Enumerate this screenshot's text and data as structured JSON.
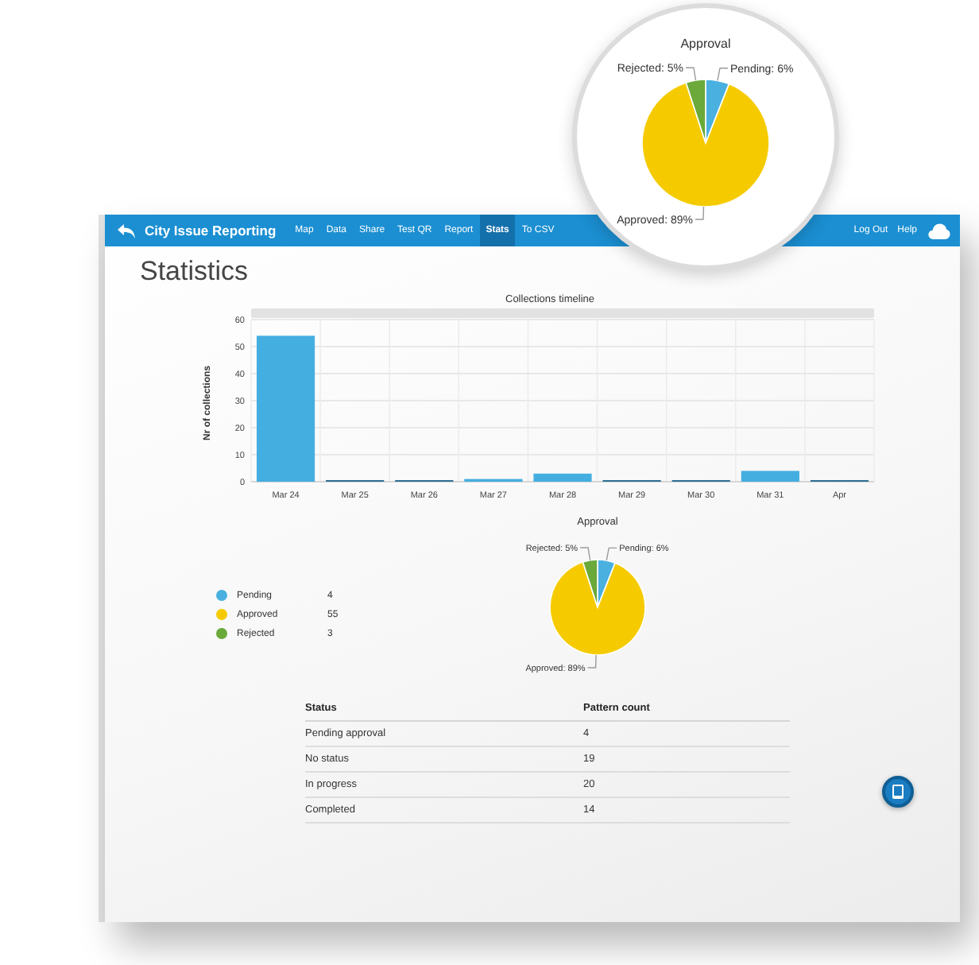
{
  "magnifier": {
    "chart_data": {
      "type": "pie",
      "title": "Approval",
      "values": [
        6,
        89,
        5
      ],
      "value_labels": [
        "Pending: 6%",
        "Approved: 89%",
        "Rejected: 5%"
      ]
    }
  },
  "app_bar": {
    "title": "City Issue Reporting",
    "nav_items": [
      {
        "label": "Map",
        "selected": false
      },
      {
        "label": "Data",
        "selected": false
      },
      {
        "label": "Share",
        "selected": false
      },
      {
        "label": "Test QR",
        "selected": false
      },
      {
        "label": "Report",
        "selected": false
      },
      {
        "label": "Stats",
        "selected": true
      },
      {
        "label": "To CSV",
        "selected": false
      }
    ],
    "right_links": [
      "Log Out",
      "Help"
    ]
  },
  "page": {
    "heading": "Statistics"
  },
  "timeline": {
    "chart_data": {
      "type": "bar",
      "title": "Collections timeline",
      "ylabel": "Nr of collections",
      "categories": [
        "Mar 24",
        "Mar 25",
        "Mar 26",
        "Mar 27",
        "Mar 28",
        "Mar 29",
        "Mar 30",
        "Mar 31",
        "Apr"
      ],
      "values": [
        54,
        0,
        0,
        1,
        3,
        0,
        0,
        4,
        0
      ],
      "ylim": [
        0,
        60
      ],
      "yticks": [
        0,
        10,
        20,
        30,
        40,
        50,
        60
      ],
      "grid": true
    }
  },
  "approval": {
    "legend": [
      {
        "label": "Pending",
        "count": "4",
        "color": "#4ab0e0"
      },
      {
        "label": "Approved",
        "count": "55",
        "color": "#f5cb00"
      },
      {
        "label": "Rejected",
        "count": "3",
        "color": "#6aa93a"
      }
    ],
    "chart_data": {
      "type": "pie",
      "title": "Approval",
      "values": [
        6,
        89,
        5
      ],
      "value_labels": [
        "Pending: 6%",
        "Approved: 89%",
        "Rejected: 5%"
      ]
    }
  },
  "table": {
    "columns": [
      "Status",
      "Pattern count"
    ],
    "rows": [
      [
        "Pending approval",
        "4"
      ],
      [
        "No status",
        "19"
      ],
      [
        "In progress",
        "20"
      ],
      [
        "Completed",
        "14"
      ]
    ]
  }
}
